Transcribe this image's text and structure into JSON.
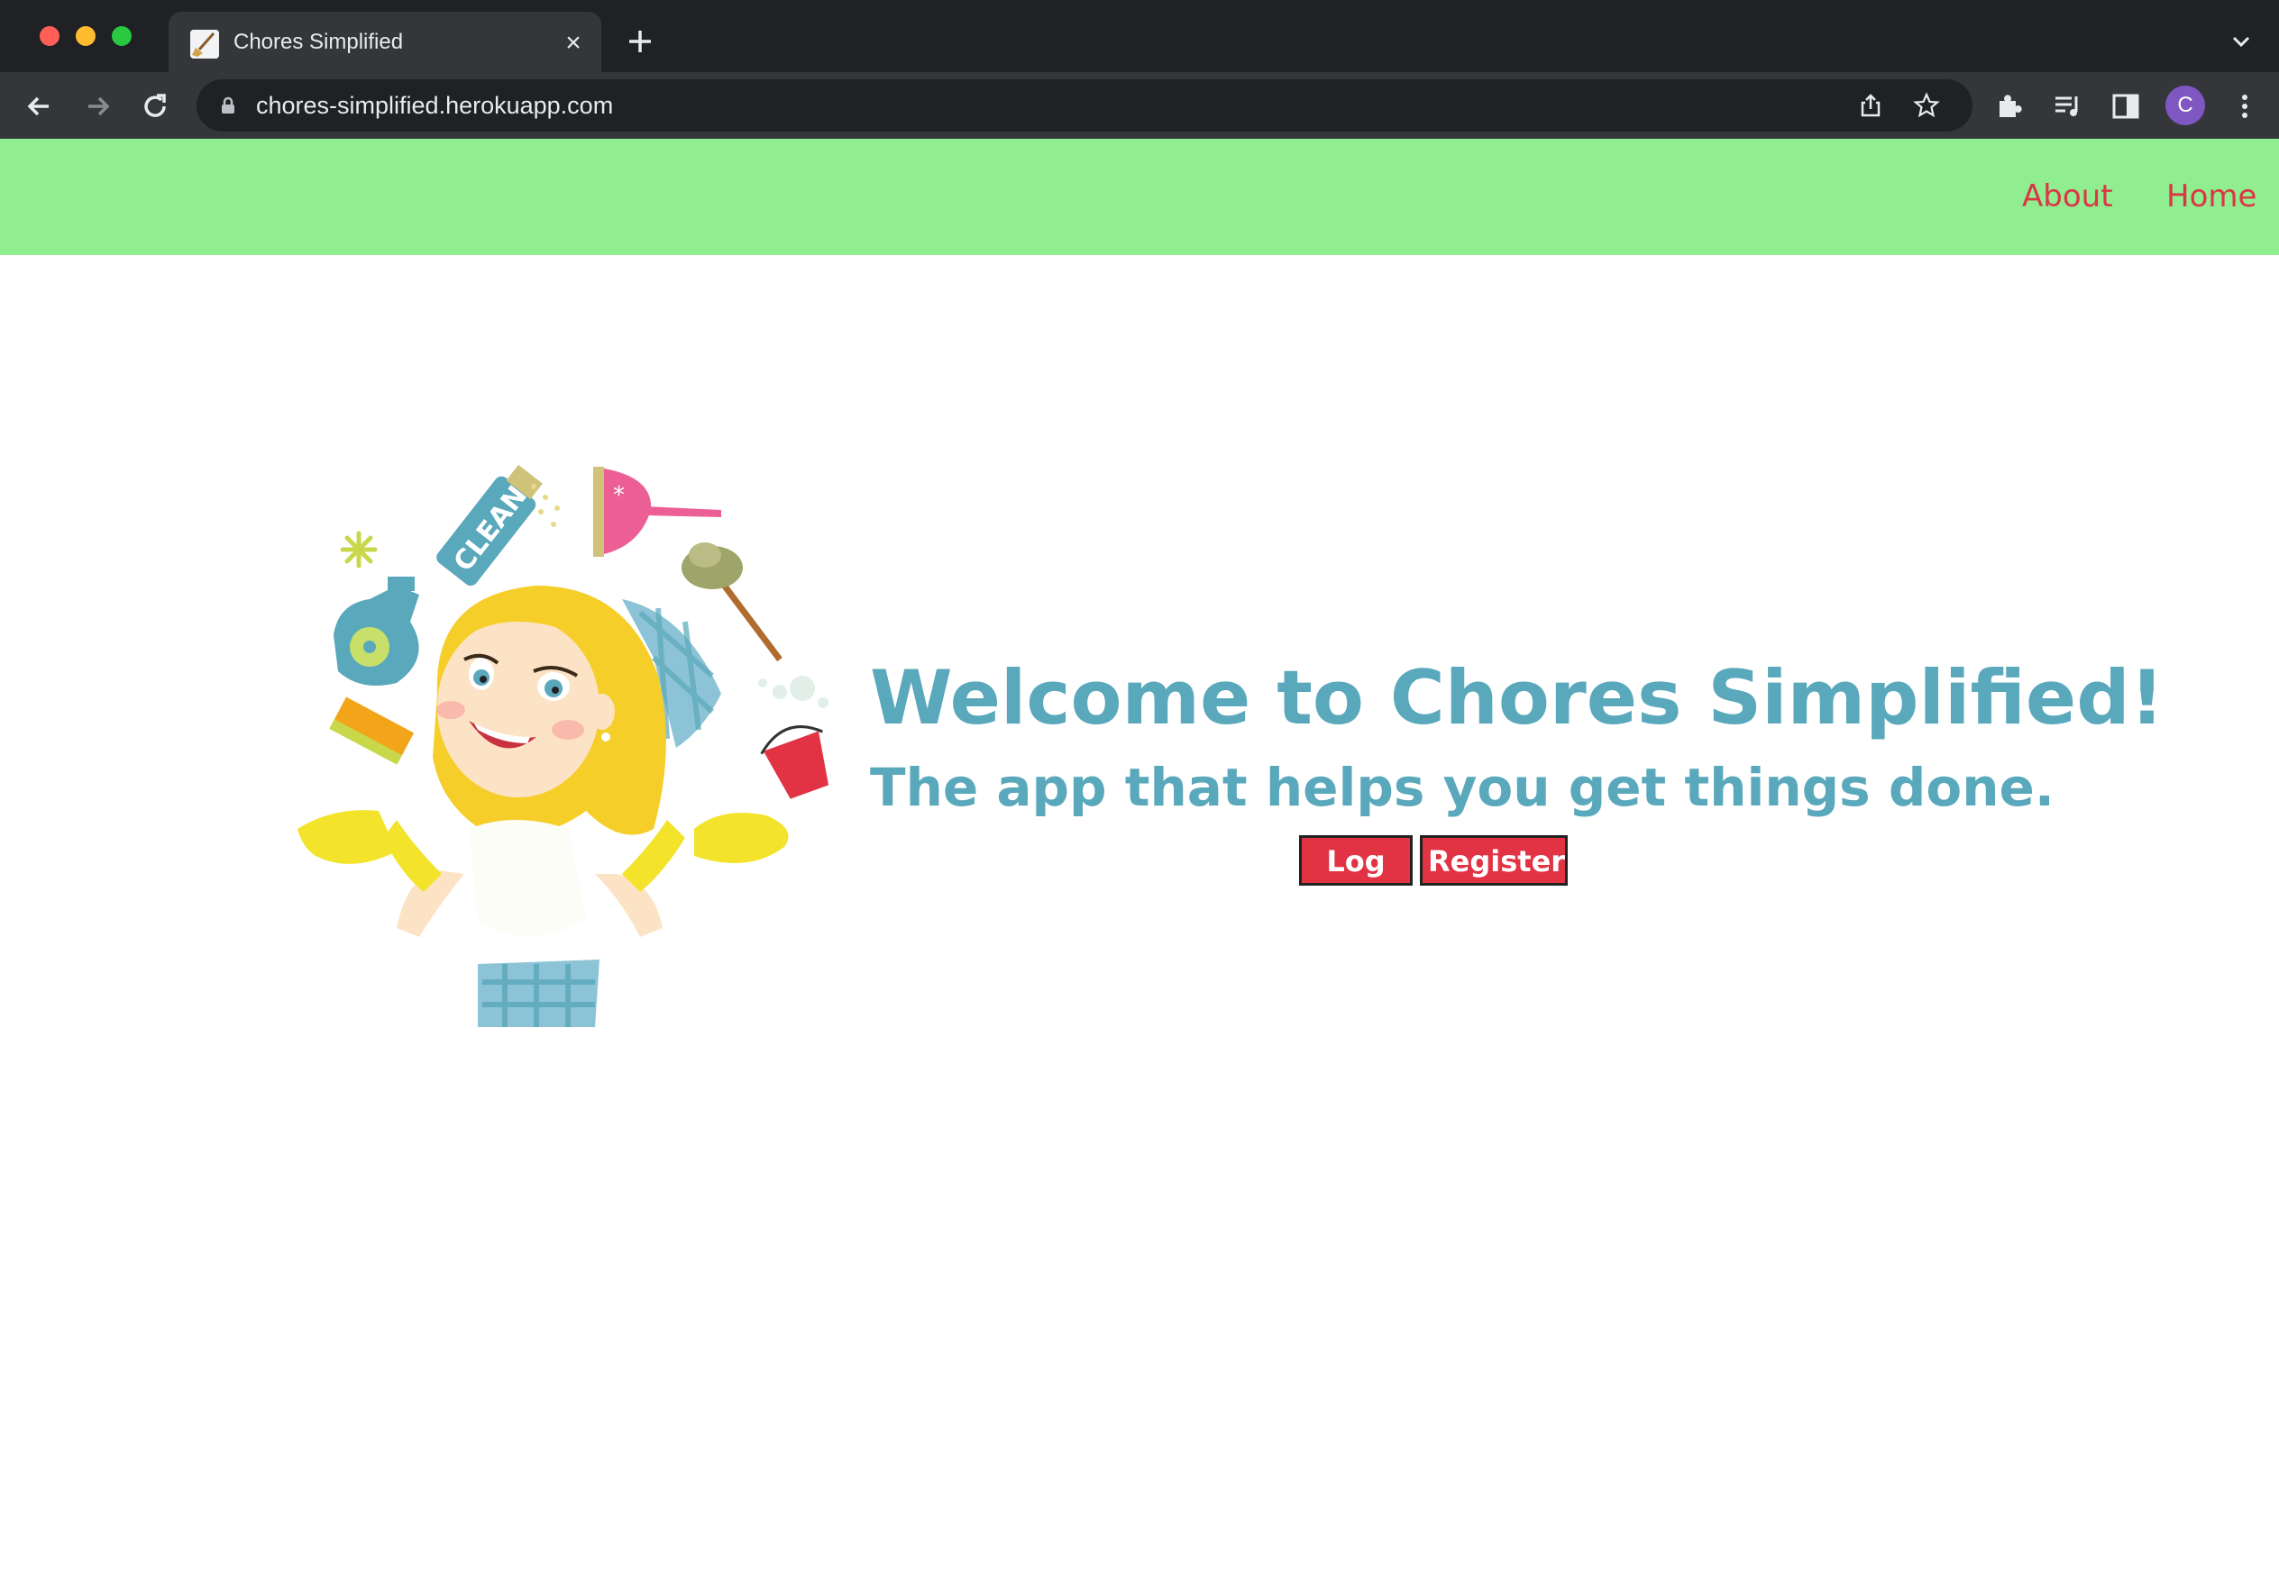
{
  "browser": {
    "tab_title": "Chores Simplified",
    "tab_close": "×",
    "url": "chores-simplified.herokuapp.com",
    "profile_initial": "C"
  },
  "nav": {
    "about": "About",
    "home": "Home"
  },
  "hero": {
    "title": "Welcome to Chores Simplified!",
    "subtitle": "The app that helps you get things done.",
    "login_label": "Log In",
    "register_label": "Register"
  },
  "colors": {
    "navbar_bg": "#90ee90",
    "nav_link": "#dc3545",
    "heading": "#5aa8bb",
    "button_bg": "#e23345"
  }
}
